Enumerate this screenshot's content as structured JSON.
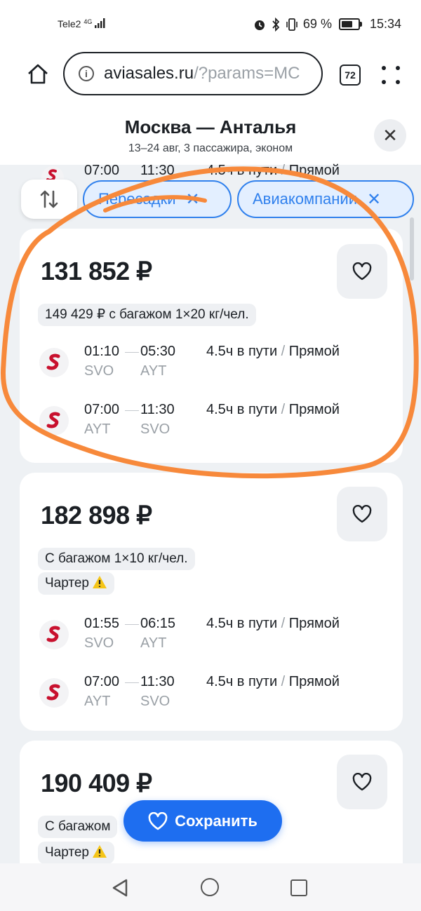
{
  "status_bar": {
    "carrier": "Tele2",
    "network": "4G",
    "battery_percent": "69 %",
    "battery_level": 0.69,
    "time": "15:34"
  },
  "browser": {
    "url_host": "aviasales.ru",
    "url_tail": "/?params=MC",
    "tab_count": "72"
  },
  "header": {
    "title": "Москва — Анталья",
    "subtitle": "13–24 авг, 3 пассажира, эконом"
  },
  "peek_segment": {
    "dep_time": "07:00",
    "arr_time": "11:30",
    "duration": "4.5ч в пути",
    "type": "Прямой"
  },
  "filters": {
    "chips": [
      {
        "label": "Пересадки"
      },
      {
        "label": "Авиакомпании"
      }
    ]
  },
  "cards": [
    {
      "price": "131 852 ₽",
      "tags": [
        "149 429 ₽ с багажом 1×20 кг/чел."
      ],
      "segments": [
        {
          "dep_time": "01:10",
          "arr_time": "05:30",
          "dep_code": "SVO",
          "arr_code": "AYT",
          "duration": "4.5ч в пути",
          "type": "Прямой"
        },
        {
          "dep_time": "07:00",
          "arr_time": "11:30",
          "dep_code": "AYT",
          "arr_code": "SVO",
          "duration": "4.5ч в пути",
          "type": "Прямой"
        }
      ]
    },
    {
      "price": "182 898 ₽",
      "tags": [
        "С багажом 1×10 кг/чел.",
        "Чартер"
      ],
      "segments": [
        {
          "dep_time": "01:55",
          "arr_time": "06:15",
          "dep_code": "SVO",
          "arr_code": "AYT",
          "duration": "4.5ч в пути",
          "type": "Прямой"
        },
        {
          "dep_time": "07:00",
          "arr_time": "11:30",
          "dep_code": "AYT",
          "arr_code": "SVO",
          "duration": "4.5ч в пути",
          "type": "Прямой"
        }
      ]
    },
    {
      "price": "190 409 ₽",
      "tags": [
        "С багажом",
        "Чартер"
      ]
    }
  ],
  "save_button": {
    "label": "Сохранить"
  },
  "colors": {
    "accent": "#1e6ef0",
    "chip_border": "#2f80ed",
    "airline_logo": "#c8102e",
    "annotation": "#f7893b"
  }
}
